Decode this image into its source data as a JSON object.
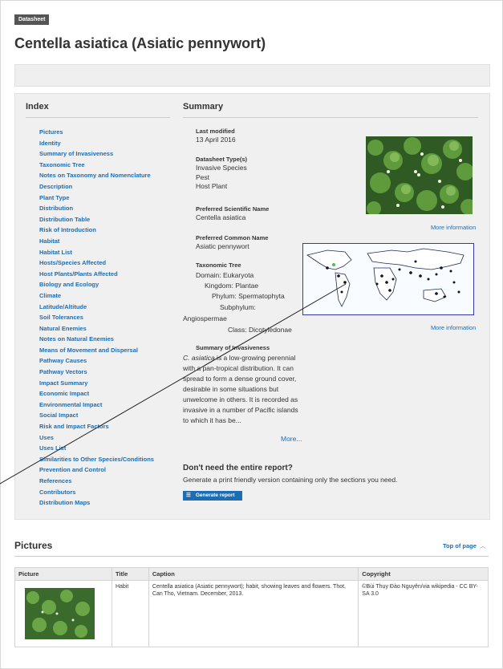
{
  "header": {
    "tag": "Datasheet",
    "title": "Centella asiatica (Asiatic pennywort)"
  },
  "index": {
    "heading": "Index",
    "items": [
      "Pictures",
      "Identity",
      "Summary of Invasiveness",
      "Taxonomic Tree",
      "Notes on Taxonomy and Nomenclature",
      "Description",
      "Plant Type",
      "Distribution",
      "Distribution Table",
      "Risk of Introduction",
      "Habitat",
      "Habitat List",
      "Hosts/Species Affected",
      "Host Plants/Plants Affected",
      "Biology and Ecology",
      "Climate",
      "Latitude/Altitude",
      "Soil Tolerances",
      "Natural Enemies",
      "Notes on Natural Enemies",
      "Means of Movement and Dispersal",
      "Pathway Causes",
      "Pathway Vectors",
      "Impact Summary",
      "Economic Impact",
      "Environmental Impact",
      "Social Impact",
      "Risk and Impact Factors",
      "Uses",
      "Uses List",
      "Similarities to Other Species/Conditions",
      "Prevention and Control",
      "References",
      "Contributors",
      "Distribution Maps"
    ]
  },
  "summary": {
    "heading": "Summary",
    "last_modified_label": "Last modified",
    "last_modified": "13 April 2016",
    "datasheet_type_label": "Datasheet Type(s)",
    "datasheet_types": [
      "Invasive Species",
      "Pest",
      "Host Plant"
    ],
    "sci_name_label": "Preferred Scientific Name",
    "sci_name": "Centella asiatica",
    "common_name_label": "Preferred Common Name",
    "common_name": "Asiatic pennywort",
    "tax_tree_label": "Taxonomic Tree",
    "tax": {
      "domain": "Domain: Eukaryota",
      "kingdom": "Kingdom: Plantae",
      "phylum": "Phylum: Spermatophyta",
      "subphylum": "Subphylum:",
      "subphylum_value": "Angiospermae",
      "class": "Class: Dicotyledonae"
    },
    "invasiveness_label": "Summary of Invasiveness",
    "invasiveness_species": "C. asiatica",
    "invasiveness_text": " is a low-growing perennial with a pan-tropical distribution. It can spread to form a dense ground cover, desirable in some situations but unwelcome in others. It is recorded as invasive in a number of Pacific islands to which it has be...",
    "more": "More...",
    "more_info_1": "More information",
    "more_info_2": "More information"
  },
  "report": {
    "heading": "Don't need the entire report?",
    "text": "Generate a print friendly version containing only the sections you need.",
    "button": "Generate report",
    "button_icon": "list-icon"
  },
  "pictures": {
    "heading": "Pictures",
    "top_link": "Top of page",
    "columns": [
      "Picture",
      "Title",
      "Caption",
      "Copyright"
    ],
    "rows": [
      {
        "title": "Habit",
        "caption": "Centella asiatica (Asiatic pennywort); habit, showing leaves and flowers. Thot, Can Tho, Vietnam. December, 2013.",
        "copyright": "©Bùi Thụy Đào Nguyên/via wikipedia - CC BY-SA 3.0"
      }
    ]
  },
  "colors": {
    "link": "#1c6db3",
    "button": "#1c6db3",
    "panel": "#f0f0f0"
  }
}
